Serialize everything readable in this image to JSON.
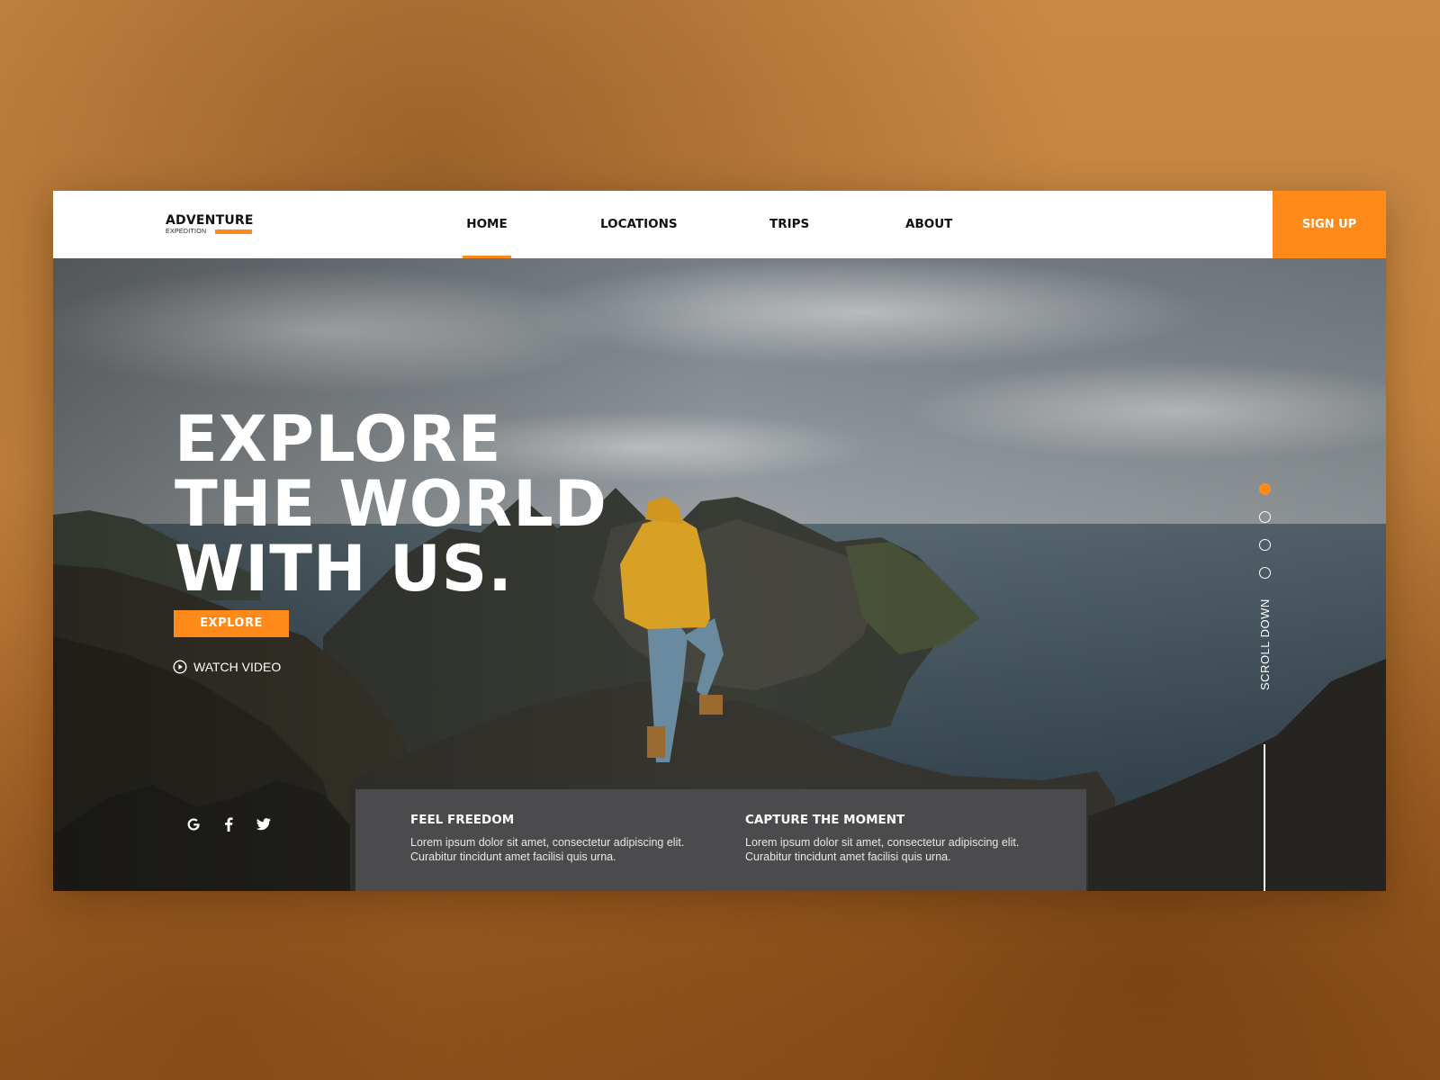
{
  "colors": {
    "accent": "#ff8a1a",
    "nav_bg": "#ffffff",
    "features_bg": "#4b4a4c"
  },
  "logo": {
    "name": "ADVENTURE",
    "tagline": "EXPEDITION"
  },
  "nav": {
    "items": [
      {
        "label": "HOME",
        "active": true
      },
      {
        "label": "LOCATIONS",
        "active": false
      },
      {
        "label": "TRIPS",
        "active": false
      },
      {
        "label": "ABOUT",
        "active": false
      }
    ],
    "signup_label": "SIGN UP"
  },
  "hero": {
    "headline": [
      "EXPLORE",
      "THE WORLD",
      "WITH US."
    ],
    "explore_label": "EXPLORE",
    "watch_video_label": "WATCH VIDEO",
    "social": [
      "google-icon",
      "facebook-icon",
      "twitter-icon"
    ],
    "slides": {
      "count": 4,
      "active_index": 0
    },
    "scroll_label": "SCROLL DOWN"
  },
  "features": [
    {
      "title": "FEEL FREEDOM",
      "text": "Lorem ipsum dolor sit amet, consectetur adipiscing elit. Curabitur tincidunt amet facilisi quis urna."
    },
    {
      "title": "CAPTURE THE MOMENT",
      "text": "Lorem ipsum dolor sit amet, consectetur adipiscing elit. Curabitur tincidunt amet facilisi quis urna."
    }
  ]
}
